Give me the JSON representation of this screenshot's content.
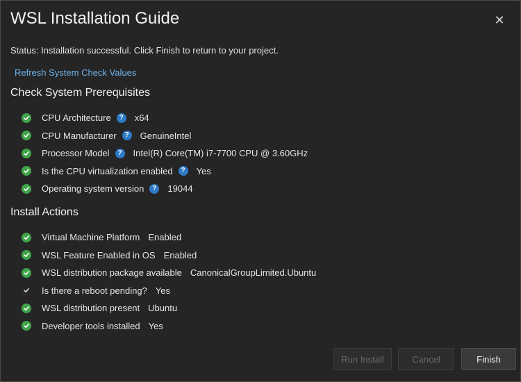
{
  "dialog": {
    "title": "WSL Installation Guide",
    "close_glyph": "✕"
  },
  "status": "Status: Installation successful. Click Finish to return to your project.",
  "refresh_link": "Refresh System Check Values",
  "prerequisites": {
    "title": "Check System Prerequisites",
    "items": [
      {
        "label": "CPU Architecture",
        "value": "x64",
        "status": "success",
        "help": true
      },
      {
        "label": "CPU Manufacturer",
        "value": "GenuineIntel",
        "status": "success",
        "help": true
      },
      {
        "label": "Processor Model",
        "value": "Intel(R) Core(TM) i7-7700 CPU @ 3.60GHz",
        "status": "success",
        "help": true
      },
      {
        "label": "Is the CPU virtualization enabled",
        "value": "Yes",
        "status": "success",
        "help": true
      },
      {
        "label": "Operating system version",
        "value": "19044",
        "status": "success",
        "help": true
      }
    ]
  },
  "install_actions": {
    "title": "Install Actions",
    "items": [
      {
        "label": "Virtual Machine Platform",
        "value": "Enabled",
        "status": "success"
      },
      {
        "label": "WSL Feature Enabled in OS",
        "value": "Enabled",
        "status": "success"
      },
      {
        "label": "WSL distribution package available",
        "value": "CanonicalGroupLimited.Ubuntu",
        "status": "success"
      },
      {
        "label": "Is there a reboot pending?",
        "value": "Yes",
        "status": "plain"
      },
      {
        "label": "WSL distribution present",
        "value": "Ubuntu",
        "status": "success"
      },
      {
        "label": "Developer tools installed",
        "value": "Yes",
        "status": "success"
      }
    ]
  },
  "help_glyph": "?",
  "buttons": {
    "run_install": "Run Install",
    "cancel": "Cancel",
    "finish": "Finish"
  },
  "colors": {
    "success": "#3fa449",
    "help": "#2d7ac7",
    "link": "#6fb3ea"
  }
}
